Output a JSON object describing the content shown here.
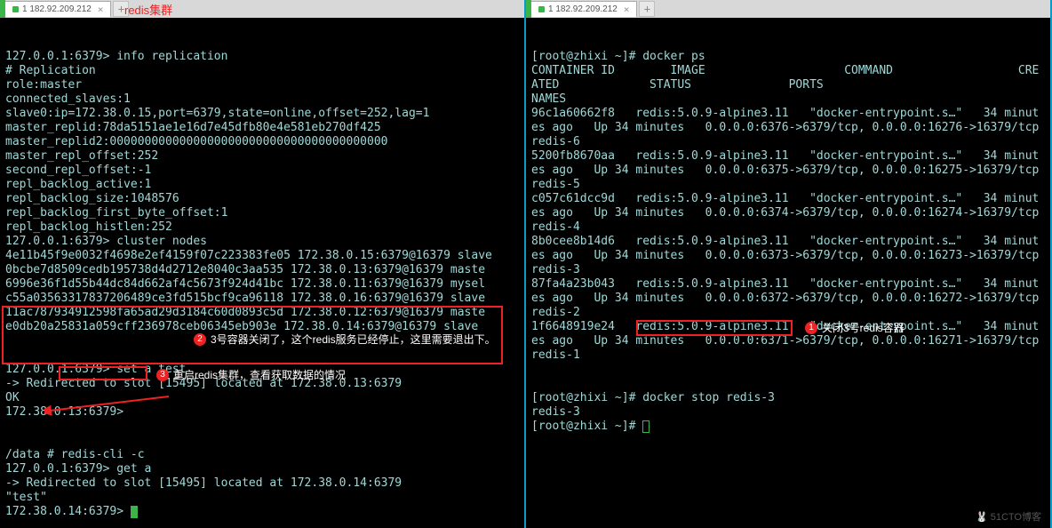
{
  "header_note": "redis集群",
  "left": {
    "tab": {
      "title": "1 182.92.209.212",
      "close": "×"
    },
    "tab_add": "+",
    "lines": [
      "127.0.0.1:6379> info replication",
      "# Replication",
      "role:master",
      "connected_slaves:1",
      "slave0:ip=172.38.0.15,port=6379,state=online,offset=252,lag=1",
      "master_replid:78da5151ae1e16d7e45dfb80e4e581eb270df425",
      "master_replid2:0000000000000000000000000000000000000000",
      "master_repl_offset:252",
      "second_repl_offset:-1",
      "repl_backlog_active:1",
      "repl_backlog_size:1048576",
      "repl_backlog_first_byte_offset:1",
      "repl_backlog_histlen:252",
      "127.0.0.1:6379> cluster nodes",
      "4e11b45f9e0032f4698e2ef4159f07c223383fe05 172.38.0.15:6379@16379 slave",
      "0bcbe7d8509cedb195738d4d2712e8040c3aa535 172.38.0.13:6379@16379 maste",
      "6996e36f1d55b44dc84d662af4c5673f924d41bc 172.38.0.11:6379@16379 mysel",
      "c55a03563317837206489ce3fd515bcf9ca96118 172.38.0.16:6379@16379 slave",
      "11ac787934912598fa65ad29d3184c60d0893c5d 172.38.0.12:6379@16379 maste",
      "e0db20a25831a059cff236978ceb06345eb903e 172.38.0.14:6379@16379 slave"
    ],
    "block1": [
      "127.0.0.1:6379> set a test",
      "-> Redirected to slot [15495] located at 172.38.0.13:6379",
      "OK",
      "172.38.0.13:6379>"
    ],
    "block2": [
      "/data # redis-cli -c",
      "127.0.0.1:6379> get a",
      "-> Redirected to slot [15495] located at 172.38.0.14:6379",
      "\"test\"",
      "172.38.0.14:6379> "
    ],
    "redbox2_text": "redis-cli -c",
    "anno2": {
      "num": "2",
      "text": "3号容器关闭了，这个redis服务已经停止，这里需要退出下。"
    },
    "anno3": {
      "num": "3",
      "text": "重启redis集群，查看获取数据的情况"
    }
  },
  "right": {
    "tab": {
      "title": "1 182.92.209.212",
      "close": "×"
    },
    "tab_add": "+",
    "lines": [
      "[root@zhixi ~]# docker ps",
      "CONTAINER ID        IMAGE                    COMMAND                  CREATED             STATUS              PORTS                                              NAMES",
      "96c1a60662f8   redis:5.0.9-alpine3.11   \"docker-entrypoint.s…\"   34 minutes ago   Up 34 minutes   0.0.0.0:6376->6379/tcp, 0.0.0.0:16276->16379/tcp   redis-6",
      "5200fb8670aa   redis:5.0.9-alpine3.11   \"docker-entrypoint.s…\"   34 minutes ago   Up 34 minutes   0.0.0.0:6375->6379/tcp, 0.0.0.0:16275->16379/tcp   redis-5",
      "c057c61dcc9d   redis:5.0.9-alpine3.11   \"docker-entrypoint.s…\"   34 minutes ago   Up 34 minutes   0.0.0.0:6374->6379/tcp, 0.0.0.0:16274->16379/tcp   redis-4",
      "8b0cee8b14d6   redis:5.0.9-alpine3.11   \"docker-entrypoint.s…\"   34 minutes ago   Up 34 minutes   0.0.0.0:6373->6379/tcp, 0.0.0.0:16273->16379/tcp   redis-3",
      "87fa4a23b043   redis:5.0.9-alpine3.11   \"docker-entrypoint.s…\"   34 minutes ago   Up 34 minutes   0.0.0.0:6372->6379/tcp, 0.0.0.0:16272->16379/tcp   redis-2",
      "1f6648919e24   redis:5.0.9-alpine3.11   \"docker-entrypoint.s…\"   34 minutes ago   Up 34 minutes   0.0.0.0:6371->6379/tcp, 0.0.0.0:16271->16379/tcp   redis-1"
    ],
    "block1": [
      "[root@zhixi ~]# docker stop redis-3",
      "redis-3",
      "[root@zhixi ~]# "
    ],
    "stop_cmd": "docker stop redis-3",
    "anno1": {
      "num": "1",
      "text": "关闭3号redis容器"
    }
  },
  "watermark": "🐰 51CTO博客"
}
